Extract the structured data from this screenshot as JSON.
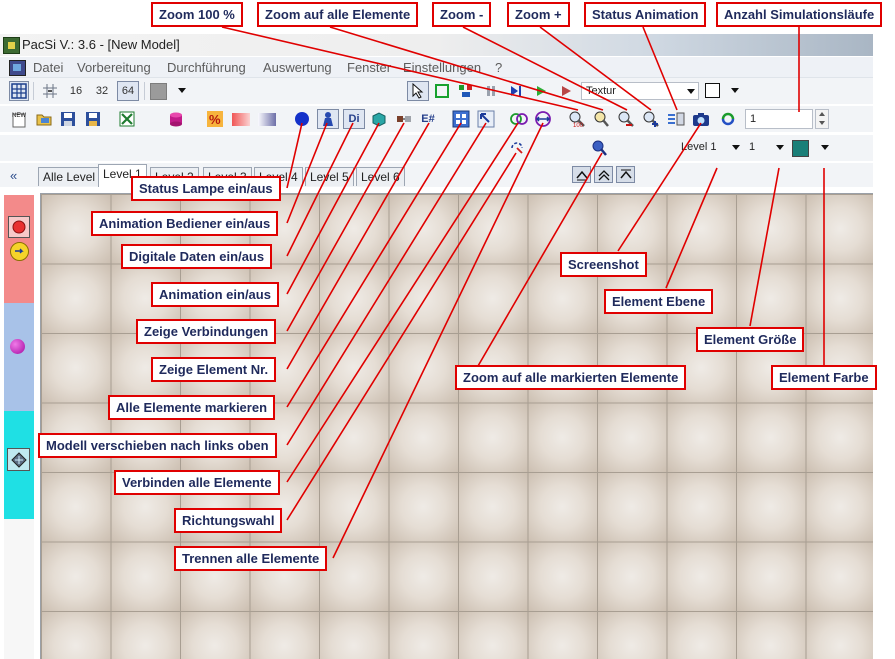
{
  "window": {
    "title": "PacSi V.: 3.6 - [New Model]"
  },
  "menu": [
    "Datei",
    "Vorbereitung",
    "Durchführung",
    "Auswertung",
    "Fenster",
    "Einstellungen",
    "?"
  ],
  "toolbar1": {
    "grid_sizes": [
      "16",
      "32",
      "64"
    ],
    "color_swatch": "#9b9b9b",
    "texture_select": "Textur"
  },
  "toolbar2": {
    "digital_label": "Di",
    "element_nr_label": "E#",
    "runs_input_value": "1"
  },
  "toolbar3": {
    "level_select": "Level 1",
    "size_select": "1",
    "color_select": "#1a7f78"
  },
  "tabs": [
    "Alle Level",
    "Level 1",
    "Level 2",
    "Level 3",
    "Level 4",
    "Level 5",
    "Level 6"
  ],
  "active_tab": "Level 1",
  "palette_colors": [
    "#f38a8a",
    "#a8c2e8",
    "#1fe0e4",
    "#f7f7f7"
  ],
  "callouts": {
    "zoom100": "Zoom 100 %",
    "zoom_all": "Zoom auf alle Elemente",
    "zoom_minus": "Zoom -",
    "zoom_plus": "Zoom +",
    "status_animation": "Status Animation",
    "sim_runs": "Anzahl Simulationsläufe",
    "status_lamp": "Status Lampe ein/aus",
    "animation_operator": "Animation Bediener ein/aus",
    "digital_data": "Digitale Daten ein/aus",
    "animation": "Animation ein/aus",
    "show_connections": "Zeige Verbindungen",
    "show_element_nr": "Zeige Element Nr.",
    "select_all": "Alle Elemente markieren",
    "move_model": "Modell verschieben nach links oben",
    "connect_all": "Verbinden alle Elemente",
    "direction": "Richtungswahl",
    "disconnect_all": "Trennen alle Elemente",
    "screenshot": "Screenshot",
    "element_level": "Element Ebene",
    "element_size": "Element Größe",
    "element_color": "Element Farbe",
    "zoom_marked": "Zoom auf alle markierten Elemente"
  }
}
